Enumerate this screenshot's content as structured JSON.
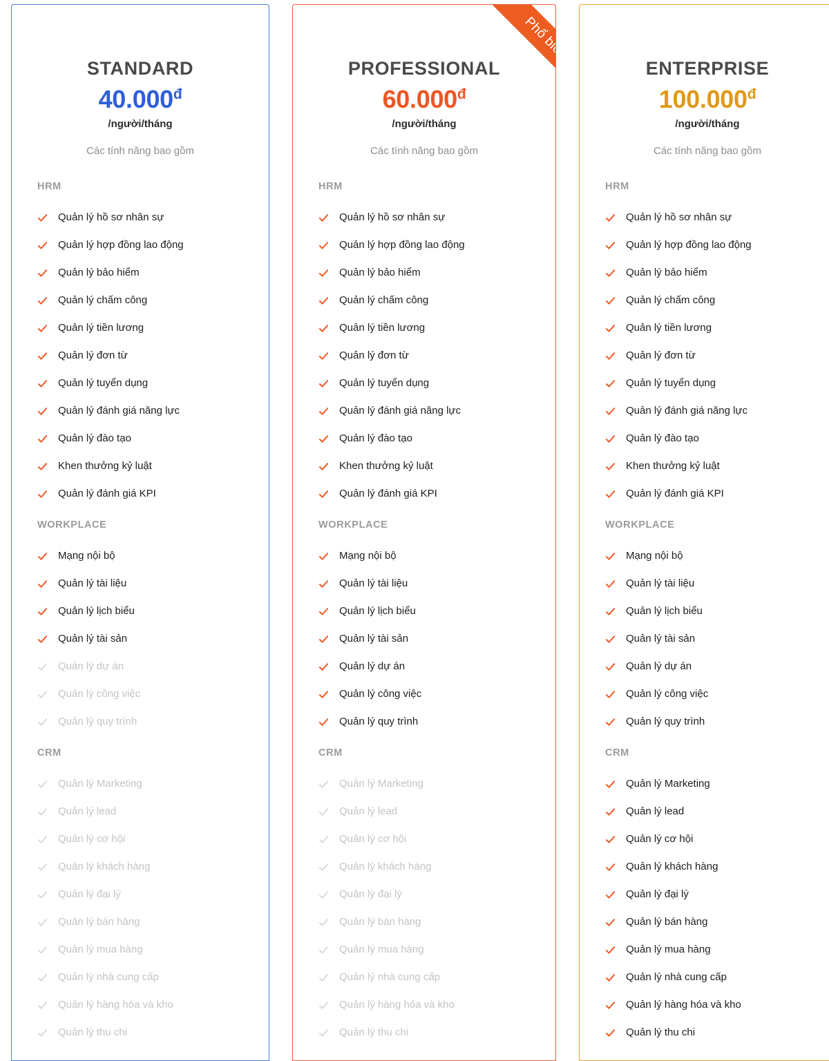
{
  "colors": {
    "standard_accent": "#2f5fd8",
    "standard_border": "#4a7fd4",
    "professional_accent": "#ee5524",
    "professional_border": "#e8603a",
    "enterprise_accent": "#e09a18",
    "enterprise_border": "#e2a332",
    "check_enabled": "#ef5723",
    "check_disabled": "#d6d6d8",
    "ribbon_bg": "#ed5c20",
    "section_head": "#9b9b9b",
    "muted_text": "#c4c4c6"
  },
  "common": {
    "period": "/người/tháng",
    "includes": "Các tính năng bao gồm",
    "currency_symbol": "đ",
    "check_icon": "check-icon"
  },
  "plans": [
    {
      "id": "standard",
      "title": "STANDARD",
      "price": "40.000",
      "currency": "đ",
      "period": "/người/tháng",
      "includes": "Các tính năng bao gồm",
      "ribbon": null,
      "sections": [
        {
          "name": "HRM",
          "items": [
            {
              "label": "Quản lý hồ sơ nhân sự",
              "enabled": true
            },
            {
              "label": "Quản lý hợp đồng lao động",
              "enabled": true
            },
            {
              "label": "Quản lý bảo hiểm",
              "enabled": true
            },
            {
              "label": "Quản lý chấm công",
              "enabled": true
            },
            {
              "label": "Quản lý tiền lương",
              "enabled": true
            },
            {
              "label": "Quản lý đơn từ",
              "enabled": true
            },
            {
              "label": "Quản lý tuyển dụng",
              "enabled": true
            },
            {
              "label": "Quản lý đánh giá năng lực",
              "enabled": true
            },
            {
              "label": "Quản lý đào tạo",
              "enabled": true
            },
            {
              "label": "Khen thưởng kỷ luật",
              "enabled": true
            },
            {
              "label": "Quản lý đánh giá KPI",
              "enabled": true
            }
          ]
        },
        {
          "name": "WORKPLACE",
          "items": [
            {
              "label": "Mạng nội bộ",
              "enabled": true
            },
            {
              "label": "Quản lý tài liệu",
              "enabled": true
            },
            {
              "label": "Quản lý lịch biểu",
              "enabled": true
            },
            {
              "label": "Quản lý tài sản",
              "enabled": true
            },
            {
              "label": "Quản lý dự án",
              "enabled": false
            },
            {
              "label": "Quản lý công việc",
              "enabled": false
            },
            {
              "label": "Quản lý quy trình",
              "enabled": false
            }
          ]
        },
        {
          "name": "CRM",
          "items": [
            {
              "label": "Quản lý Marketing",
              "enabled": false
            },
            {
              "label": "Quản lý lead",
              "enabled": false
            },
            {
              "label": "Quản lý cơ hội",
              "enabled": false
            },
            {
              "label": "Quản lý khách hàng",
              "enabled": false
            },
            {
              "label": "Quản lý đại lý",
              "enabled": false
            },
            {
              "label": "Quản lý bán hàng",
              "enabled": false
            },
            {
              "label": "Quản lý mua hàng",
              "enabled": false
            },
            {
              "label": "Quản lý nhà cung cấp",
              "enabled": false
            },
            {
              "label": "Quản lý hàng hóa và kho",
              "enabled": false
            },
            {
              "label": "Quản lý thu chi",
              "enabled": false
            }
          ]
        }
      ]
    },
    {
      "id": "professional",
      "title": "PROFESSIONAL",
      "price": "60.000",
      "currency": "đ",
      "period": "/người/tháng",
      "includes": "Các tính năng bao gồm",
      "ribbon": "Phổ biến",
      "sections": [
        {
          "name": "HRM",
          "items": [
            {
              "label": "Quản lý hồ sơ nhân sự",
              "enabled": true
            },
            {
              "label": "Quản lý hợp đồng lao động",
              "enabled": true
            },
            {
              "label": "Quản lý bảo hiểm",
              "enabled": true
            },
            {
              "label": "Quản lý chấm công",
              "enabled": true
            },
            {
              "label": "Quản lý tiền lương",
              "enabled": true
            },
            {
              "label": "Quản lý đơn từ",
              "enabled": true
            },
            {
              "label": "Quản lý tuyển dụng",
              "enabled": true
            },
            {
              "label": "Quản lý đánh giá năng lực",
              "enabled": true
            },
            {
              "label": "Quản lý đào tạo",
              "enabled": true
            },
            {
              "label": "Khen thưởng kỷ luật",
              "enabled": true
            },
            {
              "label": "Quản lý đánh giá KPI",
              "enabled": true
            }
          ]
        },
        {
          "name": "WORKPLACE",
          "items": [
            {
              "label": "Mạng nội bộ",
              "enabled": true
            },
            {
              "label": "Quản lý tài liệu",
              "enabled": true
            },
            {
              "label": "Quản lý lịch biểu",
              "enabled": true
            },
            {
              "label": "Quản lý tài sản",
              "enabled": true
            },
            {
              "label": "Quản lý dự án",
              "enabled": true
            },
            {
              "label": "Quản lý công việc",
              "enabled": true
            },
            {
              "label": "Quản lý quy trình",
              "enabled": true
            }
          ]
        },
        {
          "name": "CRM",
          "items": [
            {
              "label": "Quản lý Marketing",
              "enabled": false
            },
            {
              "label": "Quản lý lead",
              "enabled": false
            },
            {
              "label": "Quản lý cơ hội",
              "enabled": false
            },
            {
              "label": "Quản lý khách hàng",
              "enabled": false
            },
            {
              "label": "Quản lý đại lý",
              "enabled": false
            },
            {
              "label": "Quản lý bán hàng",
              "enabled": false
            },
            {
              "label": "Quản lý mua hàng",
              "enabled": false
            },
            {
              "label": "Quản lý nhà cung cấp",
              "enabled": false
            },
            {
              "label": "Quản lý hàng hóa và kho",
              "enabled": false
            },
            {
              "label": "Quản lý thu chi",
              "enabled": false
            }
          ]
        }
      ]
    },
    {
      "id": "enterprise",
      "title": "ENTERPRISE",
      "price": "100.000",
      "currency": "đ",
      "period": "/người/tháng",
      "includes": "Các tính năng bao gồm",
      "ribbon": null,
      "sections": [
        {
          "name": "HRM",
          "items": [
            {
              "label": "Quản lý hồ sơ nhân sự",
              "enabled": true
            },
            {
              "label": "Quản lý hợp đồng lao động",
              "enabled": true
            },
            {
              "label": "Quản lý bảo hiểm",
              "enabled": true
            },
            {
              "label": "Quản lý chấm công",
              "enabled": true
            },
            {
              "label": "Quản lý tiền lương",
              "enabled": true
            },
            {
              "label": "Quản lý đơn từ",
              "enabled": true
            },
            {
              "label": "Quản lý tuyển dụng",
              "enabled": true
            },
            {
              "label": "Quản lý đánh giá năng lực",
              "enabled": true
            },
            {
              "label": "Quản lý đào tạo",
              "enabled": true
            },
            {
              "label": "Khen thưởng kỷ luật",
              "enabled": true
            },
            {
              "label": "Quản lý đánh giá KPI",
              "enabled": true
            }
          ]
        },
        {
          "name": "WORKPLACE",
          "items": [
            {
              "label": "Mạng nội bộ",
              "enabled": true
            },
            {
              "label": "Quản lý tài liệu",
              "enabled": true
            },
            {
              "label": "Quản lý lịch biểu",
              "enabled": true
            },
            {
              "label": "Quản lý tài sản",
              "enabled": true
            },
            {
              "label": "Quản lý dự án",
              "enabled": true
            },
            {
              "label": "Quản lý công việc",
              "enabled": true
            },
            {
              "label": "Quản lý quy trình",
              "enabled": true
            }
          ]
        },
        {
          "name": "CRM",
          "items": [
            {
              "label": "Quản lý Marketing",
              "enabled": true
            },
            {
              "label": "Quản lý lead",
              "enabled": true
            },
            {
              "label": "Quản lý cơ hội",
              "enabled": true
            },
            {
              "label": "Quản lý khách hàng",
              "enabled": true
            },
            {
              "label": "Quản lý đại lý",
              "enabled": true
            },
            {
              "label": "Quản lý bán hàng",
              "enabled": true
            },
            {
              "label": "Quản lý mua hàng",
              "enabled": true
            },
            {
              "label": "Quản lý nhà cung cấp",
              "enabled": true
            },
            {
              "label": "Quản lý hàng hóa và kho",
              "enabled": true
            },
            {
              "label": "Quản lý thu chi",
              "enabled": true
            }
          ]
        }
      ]
    }
  ]
}
